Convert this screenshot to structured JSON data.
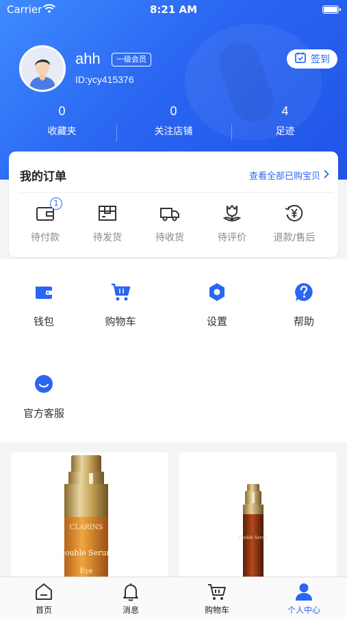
{
  "status_bar": {
    "carrier": "Carrier",
    "time": "8:21 AM"
  },
  "profile": {
    "username": "ahh",
    "level": "一级会员",
    "id_text": "ID:ycy415376",
    "checkin_label": "签到"
  },
  "stats": [
    {
      "value": "0",
      "label": "收藏夹"
    },
    {
      "value": "0",
      "label": "关注店铺"
    },
    {
      "value": "4",
      "label": "足迹"
    }
  ],
  "orders": {
    "title": "我的订单",
    "view_all": "查看全部已购宝贝",
    "items": [
      {
        "label": "待付款",
        "icon": "wallet-card-icon",
        "badge": "1"
      },
      {
        "label": "待发货",
        "icon": "package-icon"
      },
      {
        "label": "待收货",
        "icon": "truck-icon"
      },
      {
        "label": "待评价",
        "icon": "tulip-review-icon"
      },
      {
        "label": "退款/售后",
        "icon": "refund-yen-icon"
      }
    ]
  },
  "tools": [
    {
      "label": "钱包",
      "icon": "wallet-icon"
    },
    {
      "label": "购物车",
      "icon": "cart-icon"
    },
    {
      "label": "设置",
      "icon": "gear-icon"
    },
    {
      "label": "帮助",
      "icon": "help-icon"
    },
    {
      "label": "官方客服",
      "icon": "customer-service-icon"
    }
  ],
  "products": [
    {
      "brand_text": "CLARINS",
      "name_text": "Double Serum",
      "sub_text": "Eye"
    },
    {
      "brand_text": "",
      "name_text": "Double Serum",
      "sub_text": ""
    }
  ],
  "tabbar": [
    {
      "label": "首页",
      "icon": "home-icon"
    },
    {
      "label": "消息",
      "icon": "bell-icon"
    },
    {
      "label": "购物车",
      "icon": "cart-icon"
    },
    {
      "label": "个人中心",
      "icon": "user-icon",
      "active": true
    }
  ],
  "colors": {
    "accent": "#2a66f2",
    "header_start": "#3f8bff",
    "header_end": "#1f54e8"
  }
}
